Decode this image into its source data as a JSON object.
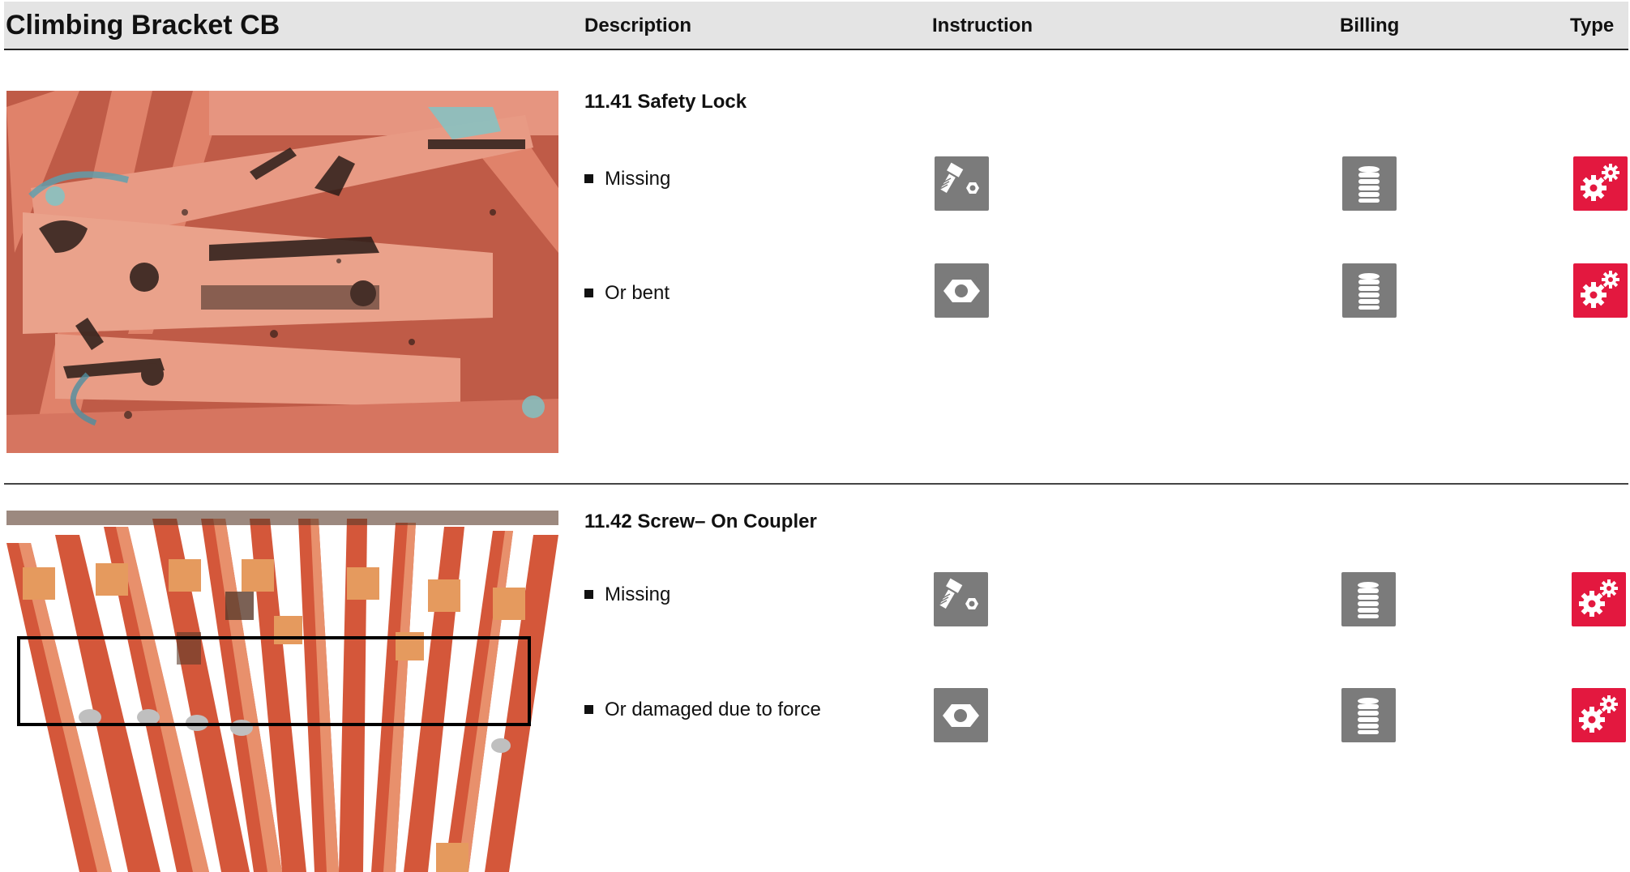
{
  "header": {
    "title": "Climbing Bracket CB",
    "col_description": "Description",
    "col_instruction": "Instruction",
    "col_billing": "Billing",
    "col_type": "Type"
  },
  "sections": [
    {
      "title": "11.41 Safety Lock",
      "rows": [
        {
          "label": "Missing",
          "instruction_icon": "bolt-nut-icon",
          "billing_icon": "coin-stack-icon",
          "type_icon": "gears-icon"
        },
        {
          "label": "Or bent",
          "instruction_icon": "damaged-nut-icon",
          "billing_icon": "coin-stack-icon",
          "type_icon": "gears-icon"
        }
      ]
    },
    {
      "title": "11.42 Screw– On Coupler",
      "rows": [
        {
          "label": "Missing",
          "instruction_icon": "bolt-nut-icon",
          "billing_icon": "coin-stack-icon",
          "type_icon": "gears-icon"
        },
        {
          "label": "Or damaged due to force",
          "instruction_icon": "damaged-nut-icon",
          "billing_icon": "coin-stack-icon",
          "type_icon": "gears-icon"
        }
      ]
    }
  ],
  "colors": {
    "header_bg": "#e4e4e4",
    "icon_gray": "#7b7b7b",
    "icon_red": "#e3183f",
    "photo_orange": "#e0826a"
  }
}
